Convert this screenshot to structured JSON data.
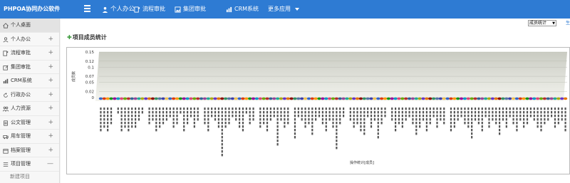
{
  "app": {
    "title": "PHPOA协同办公软件"
  },
  "topnav": [
    {
      "label": "个人办公",
      "icon": "user-icon"
    },
    {
      "label": "流程审批",
      "icon": "flow-icon"
    },
    {
      "label": "集团审批",
      "icon": "image-icon"
    },
    {
      "label": "CRM系统",
      "icon": "bar-chart-icon"
    },
    {
      "label": "更多应用",
      "icon": "caret-down-icon"
    }
  ],
  "sidebar": {
    "items": [
      {
        "label": "个人桌面",
        "icon": "home-icon",
        "toggle": ""
      },
      {
        "label": "个人办公",
        "icon": "user-icon",
        "toggle": "+"
      },
      {
        "label": "流程审批",
        "icon": "flow-icon",
        "toggle": "+"
      },
      {
        "label": "集团审批",
        "icon": "edit-icon",
        "toggle": "+"
      },
      {
        "label": "CRM系统",
        "icon": "bar-chart-icon",
        "toggle": "+"
      },
      {
        "label": "行政办公",
        "icon": "refresh-icon",
        "toggle": "+"
      },
      {
        "label": "人力资源",
        "icon": "people-icon",
        "toggle": "+"
      },
      {
        "label": "公文管理",
        "icon": "doc-icon",
        "toggle": "+"
      },
      {
        "label": "用车管理",
        "icon": "car-icon",
        "toggle": "+"
      },
      {
        "label": "档案管理",
        "icon": "archive-icon",
        "toggle": "+"
      },
      {
        "label": "项目管理",
        "icon": "list-icon",
        "toggle": "—"
      }
    ],
    "sub_items": [
      "新建项目"
    ]
  },
  "main": {
    "page_title": "项目成员统计",
    "filter_select": "成员统计",
    "filter_link": "生"
  },
  "chart_data": {
    "type": "bar",
    "title": "",
    "xlabel": "操作统计[成员]",
    "ylabel": "成员数",
    "ylim": [
      0,
      0.15
    ],
    "yticks": [
      "0.15",
      "0.12",
      "0.1",
      "0.07",
      "0.05",
      "0.02",
      "0"
    ],
    "bar_count": 135,
    "values_note": "all bars at 0",
    "grid": true,
    "palette": [
      "#3366cc",
      "#dc3912",
      "#ff9900",
      "#109618",
      "#990099",
      "#0099c6",
      "#dd4477",
      "#66aa00",
      "#b82e2e",
      "#316395",
      "#994499",
      "#22aa99",
      "#aaaa11",
      "#6633cc",
      "#e67300",
      "#8b0707",
      "#329262",
      "#5574a6",
      "#3b3eac",
      "#f2c14e"
    ]
  },
  "colors": {
    "topbar": "#2e7bd3",
    "plot_bg_top": "#c9cbc2",
    "plot_bg_bottom": "#f4f4ef"
  }
}
